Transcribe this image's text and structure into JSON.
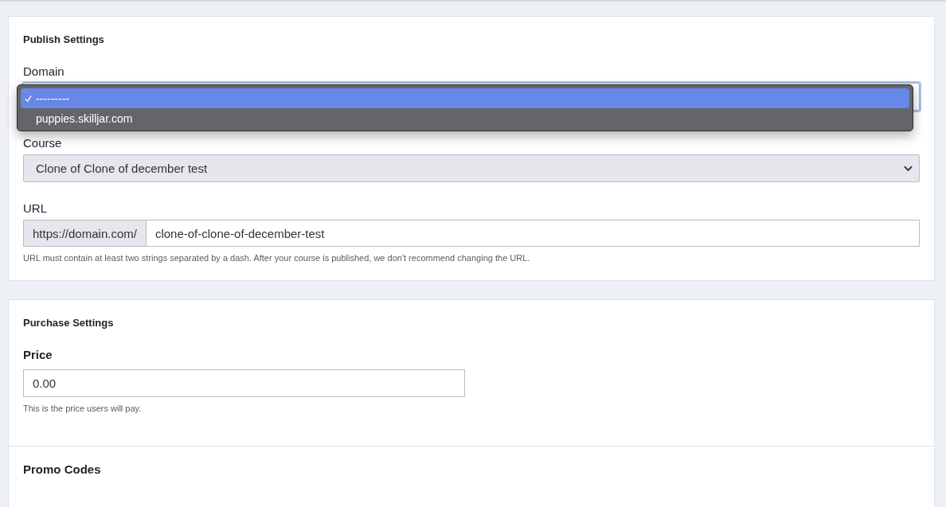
{
  "publish_settings": {
    "title": "Publish Settings",
    "domain": {
      "label": "Domain",
      "expanded": true,
      "options": [
        {
          "label": "---------",
          "selected": true
        },
        {
          "label": "puppies.skilljar.com",
          "selected": false
        }
      ]
    },
    "course": {
      "label": "Course",
      "value": "Clone of Clone of december test"
    },
    "url": {
      "label": "URL",
      "prefix": "https://domain.com/",
      "value": "clone-of-clone-of-december-test",
      "help": "URL must contain at least two strings separated by a dash. After your course is published, we don't recommend changing the URL."
    }
  },
  "purchase_settings": {
    "title": "Purchase Settings",
    "price": {
      "label": "Price",
      "value": "0.00",
      "help": "This is the price users will pay."
    },
    "promo_codes": {
      "title": "Promo Codes"
    }
  }
}
